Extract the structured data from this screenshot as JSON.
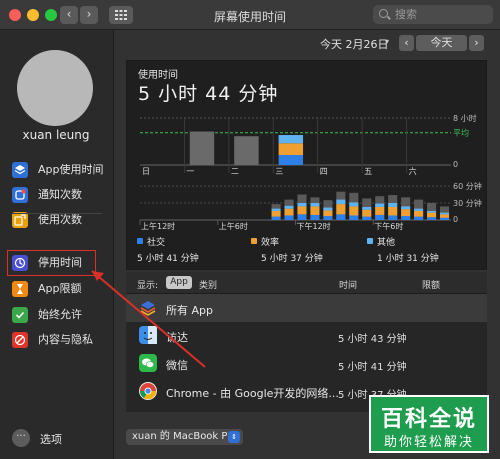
{
  "window": {
    "title": "屏幕使用时间",
    "search_placeholder": "搜索",
    "nav_back": "‹",
    "nav_forward": "›",
    "grid_icon": "grid-icon"
  },
  "sidebar": {
    "username": "xuan leung",
    "items": [
      {
        "label": "App使用时间",
        "icon": "layers-icon",
        "color": "#2f6fd6"
      },
      {
        "label": "通知次数",
        "icon": "bell-icon",
        "color": "#2f6fd6"
      },
      {
        "label": "使用次数",
        "icon": "pickup-icon",
        "color": "#e8a20c"
      },
      {
        "label": "停用时间",
        "icon": "downtime-icon",
        "color": "#4a4fd1"
      },
      {
        "label": "App限额",
        "icon": "hourglass-icon",
        "color": "#f08a15"
      },
      {
        "label": "始终允许",
        "icon": "check-shield-icon",
        "color": "#3aa84a"
      },
      {
        "label": "内容与隐私",
        "icon": "no-entry-icon",
        "color": "#e0352b"
      }
    ],
    "options_label": "选项"
  },
  "datebar": {
    "date": "今天 2月26日",
    "prev": "‹",
    "today": "今天",
    "next": "›"
  },
  "usage": {
    "caption": "使用时间",
    "total": "5 小时 44 分钟"
  },
  "chart_data": [
    {
      "type": "bar",
      "title": "",
      "categories": [
        "日",
        "一",
        "二",
        "三",
        "四",
        "五",
        "六"
      ],
      "values": [
        0,
        5.7,
        4.9,
        5.73,
        0,
        0,
        0
      ],
      "ylim": [
        0,
        8
      ],
      "y_ticks": [
        "8 小时",
        "0"
      ],
      "average_label": "平均",
      "average_value": 5.5,
      "highlight_category": "三",
      "series_breakdown_for_highlight": [
        {
          "name": "社交",
          "value": 1.7
        },
        {
          "name": "效率",
          "value": 2.0
        },
        {
          "name": "其他",
          "value": 1.4
        }
      ],
      "colors": {
        "social": "#2f7fe8",
        "productivity": "#f0a030",
        "other": "#5fb3f0",
        "neutral": "#6a6a6a",
        "average": "#3fbf5a"
      }
    },
    {
      "type": "bar",
      "title": "",
      "x_ticks": [
        "上午12时",
        "上午6时",
        "下午12时",
        "下午6时"
      ],
      "y_ticks": [
        "60 分钟",
        "30 分钟",
        "0"
      ],
      "ylim": [
        0,
        60
      ],
      "hours": [
        10,
        11,
        12,
        13,
        14,
        15,
        16,
        17,
        18,
        19,
        20,
        21,
        22,
        23
      ],
      "series": [
        {
          "name": "社交",
          "values": [
            6,
            8,
            10,
            9,
            7,
            10,
            8,
            6,
            9,
            8,
            7,
            6,
            5,
            4
          ]
        },
        {
          "name": "效率",
          "values": [
            10,
            12,
            14,
            15,
            10,
            18,
            16,
            12,
            14,
            15,
            12,
            10,
            8,
            6
          ]
        },
        {
          "name": "其他",
          "values": [
            4,
            5,
            6,
            6,
            5,
            8,
            7,
            5,
            6,
            7,
            5,
            4,
            3,
            3
          ]
        }
      ],
      "totals_background": [
        28,
        36,
        45,
        40,
        35,
        50,
        48,
        38,
        42,
        44,
        40,
        36,
        30,
        24
      ]
    }
  ],
  "categories": [
    {
      "name": "社交",
      "time": "5 小时 41 分钟",
      "color": "#2f7fe8"
    },
    {
      "name": "效率",
      "time": "5 小时 37 分钟",
      "color": "#f0a030"
    },
    {
      "name": "其他",
      "time": "1 小时 31 分钟",
      "color": "#5fb3f0"
    }
  ],
  "list": {
    "show_label": "显示:",
    "show_value": "App",
    "col_category": "类别",
    "col_time": "时间",
    "col_limit": "限额",
    "rows": [
      {
        "name": "所有 App",
        "time": "",
        "icon": "layers-icon",
        "icon_color": "#3a6ed8",
        "selected": true
      },
      {
        "name": "访达",
        "time": "5 小时 43 分钟",
        "icon": "finder-icon",
        "icon_color": "#3d8ee8",
        "selected": false
      },
      {
        "name": "微信",
        "time": "5 小时 41 分钟",
        "icon": "wechat-icon",
        "icon_color": "#2db84c",
        "selected": false
      },
      {
        "name": "Chrome - 由 Google开发的网络...",
        "time": "5 小时 37 分钟",
        "icon": "chrome-icon",
        "icon_color": "#e8e8e8",
        "selected": false
      }
    ]
  },
  "device": "xuan 的 MacBook Pro",
  "watermark": {
    "top": "百科全说",
    "bottom": "助你轻松解决"
  }
}
